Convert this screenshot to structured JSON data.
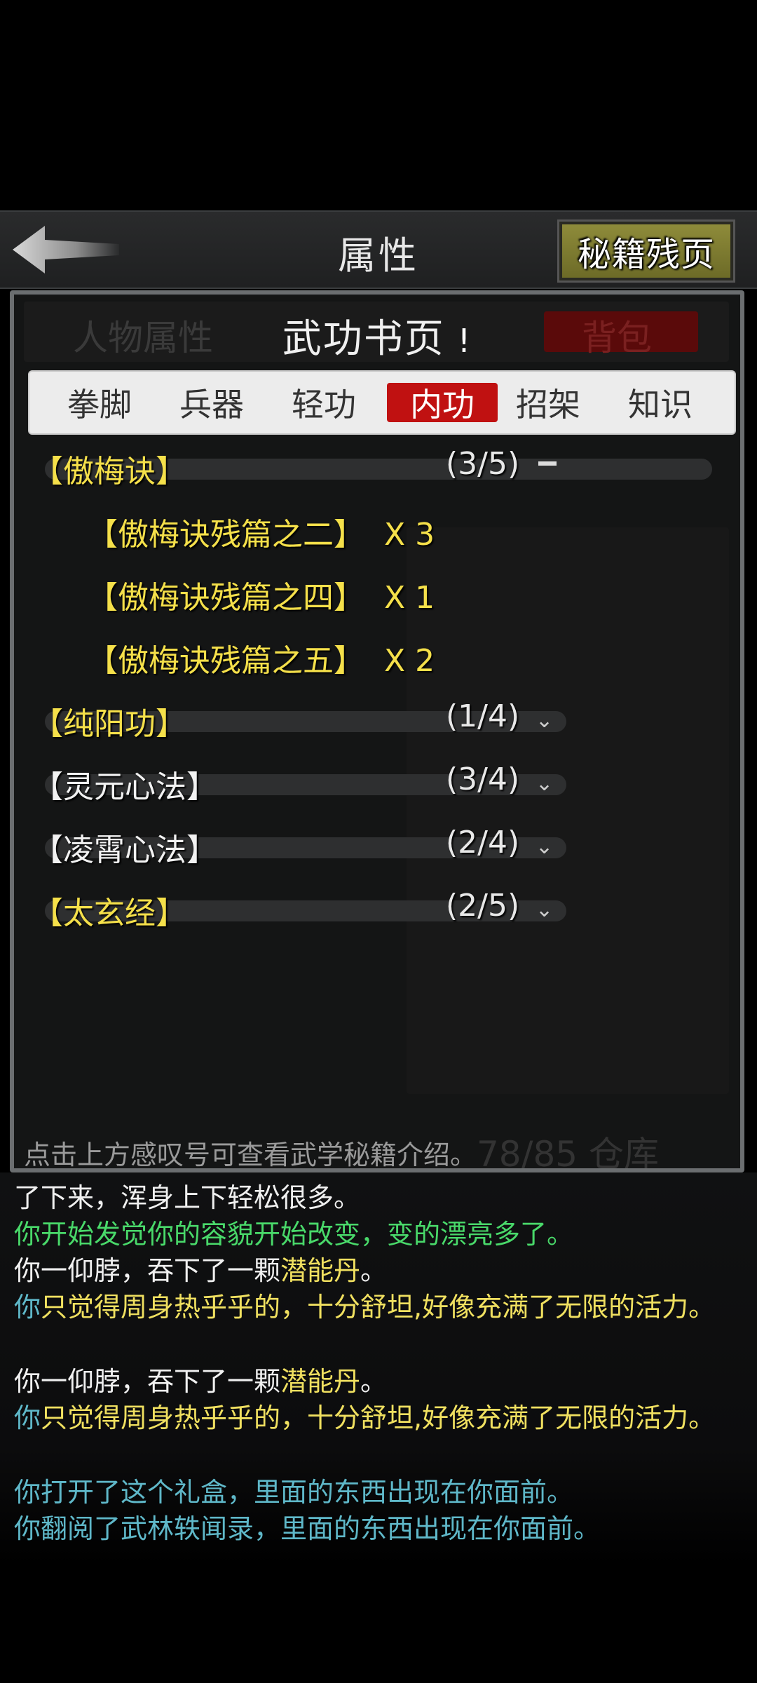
{
  "header": {
    "title": "属性",
    "fragment_button": "秘籍残页"
  },
  "panel": {
    "title": "武功书页",
    "info_button": "!",
    "background_ghost": {
      "left_tab": "人物属性",
      "right_tab": "背包",
      "counter": "78/85 仓库"
    },
    "hint": "点击上方感叹号可查看武学秘籍介绍。"
  },
  "tabs": [
    {
      "label": "拳脚"
    },
    {
      "label": "兵器"
    },
    {
      "label": "轻功"
    },
    {
      "label": "内功",
      "active": true
    },
    {
      "label": "招架"
    },
    {
      "label": "知识"
    }
  ],
  "groups": [
    {
      "name": "【傲梅诀】",
      "count": "(3/5)",
      "expanded": true,
      "items": [
        {
          "text": "【傲梅诀残篇之二】  X 3"
        },
        {
          "text": "【傲梅诀残篇之四】  X 1"
        },
        {
          "text": "【傲梅诀残篇之五】  X 2"
        }
      ]
    },
    {
      "name": "【纯阳功】",
      "count": "(1/4)",
      "expanded": false
    },
    {
      "name": "【灵元心法】",
      "count": "(3/4)",
      "expanded": false
    },
    {
      "name": "【凌霄心法】",
      "count": "(2/4)",
      "expanded": false
    },
    {
      "name": "【太玄经】",
      "count": "(2/5)",
      "expanded": false
    }
  ],
  "log": [
    {
      "segments": [
        {
          "text": "了下来，浑身上下轻松很多。",
          "color": "#f0f0f0"
        }
      ]
    },
    {
      "segments": [
        {
          "text": "你开始发觉你的容貌开始改变，变的漂亮多了。",
          "color": "#49d96a"
        }
      ]
    },
    {
      "segments": [
        {
          "text": "你一仰脖，吞下了一颗",
          "color": "#f0f0f0"
        },
        {
          "text": "潜能丹",
          "color": "#f0e060"
        },
        {
          "text": "。",
          "color": "#f0f0f0"
        }
      ]
    },
    {
      "segments": [
        {
          "text": "你",
          "color": "#5fb8c9"
        },
        {
          "text": "只觉得周身热乎乎的，十分舒坦,好像充满了无限的活力。",
          "color": "#f0e060"
        }
      ]
    },
    {
      "segments": [
        {
          "text": "你一仰脖，吞下了一颗",
          "color": "#f0f0f0"
        },
        {
          "text": "潜能丹",
          "color": "#f0e060"
        },
        {
          "text": "。",
          "color": "#f0f0f0"
        }
      ]
    },
    {
      "segments": [
        {
          "text": "你",
          "color": "#5fb8c9"
        },
        {
          "text": "只觉得周身热乎乎的，十分舒坦,好像充满了无限的活力。",
          "color": "#f0e060"
        }
      ]
    },
    {
      "segments": [
        {
          "text": "你打开了这个礼盒，里面的东西出现在你面前。",
          "color": "#5fb8c9"
        }
      ]
    },
    {
      "segments": [
        {
          "text": "你翻阅了武林轶闻录，里面的东西出现在你面前。",
          "color": "#5fb8c9"
        }
      ]
    }
  ],
  "colors": {
    "active_tab": "#c01111",
    "group_gold": "#f5e04a",
    "button_olive": "#8e8b3a"
  },
  "icons": {
    "back": "back-arrow-icon",
    "expand": "minus-icon",
    "collapse": "chevron-down-icon"
  }
}
